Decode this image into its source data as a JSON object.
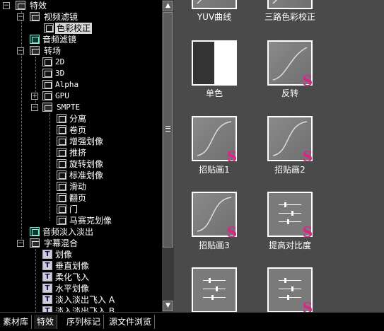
{
  "tree": {
    "items": [
      {
        "label": "特效"
      },
      {
        "label": "视频滤镜"
      },
      {
        "label": "色彩校正"
      },
      {
        "label": "音频滤镜"
      },
      {
        "label": "转场"
      },
      {
        "label": "2D"
      },
      {
        "label": "3D"
      },
      {
        "label": "Alpha"
      },
      {
        "label": "GPU"
      },
      {
        "label": "SMPTE"
      },
      {
        "label": "分离"
      },
      {
        "label": "卷页"
      },
      {
        "label": "增强划像"
      },
      {
        "label": "推挤"
      },
      {
        "label": "旋转划像"
      },
      {
        "label": "标准划像"
      },
      {
        "label": "滑动"
      },
      {
        "label": "翻页"
      },
      {
        "label": "门"
      },
      {
        "label": "马赛克划像"
      },
      {
        "label": "音频淡入淡出"
      },
      {
        "label": "字幕混合"
      },
      {
        "label": "划像"
      },
      {
        "label": "垂直划像"
      },
      {
        "label": "柔化飞入"
      },
      {
        "label": "水平划像"
      },
      {
        "label": "淡入淡出飞入 A"
      },
      {
        "label": "淡入淡出飞入 B"
      }
    ]
  },
  "effects": {
    "items": [
      {
        "label": "YUV曲线",
        "icon": "curve-effect-icon"
      },
      {
        "label": "三路色彩校正",
        "icon": "curve-effect-icon"
      },
      {
        "label": "单色",
        "icon": "monochrome-effect-icon"
      },
      {
        "label": "反转",
        "icon": "curve-effect-icon"
      },
      {
        "label": "招贴画1",
        "icon": "curve-effect-icon"
      },
      {
        "label": "招贴画2",
        "icon": "curve-effect-icon"
      },
      {
        "label": "招贴画3",
        "icon": "curve-effect-icon"
      },
      {
        "label": "提高对比度",
        "icon": "sliders-effect-icon"
      },
      {
        "label": "",
        "icon": "sliders-effect-icon"
      },
      {
        "label": "",
        "icon": "sliders-effect-icon"
      }
    ]
  },
  "tabs": [
    {
      "label": "素材库"
    },
    {
      "label": "特效"
    },
    {
      "label": "序列标记"
    },
    {
      "label": "源文件浏览"
    }
  ],
  "colors": {
    "badge": "#e0218a",
    "selection": "#d8d8d8",
    "background": "#4a4a4a"
  }
}
